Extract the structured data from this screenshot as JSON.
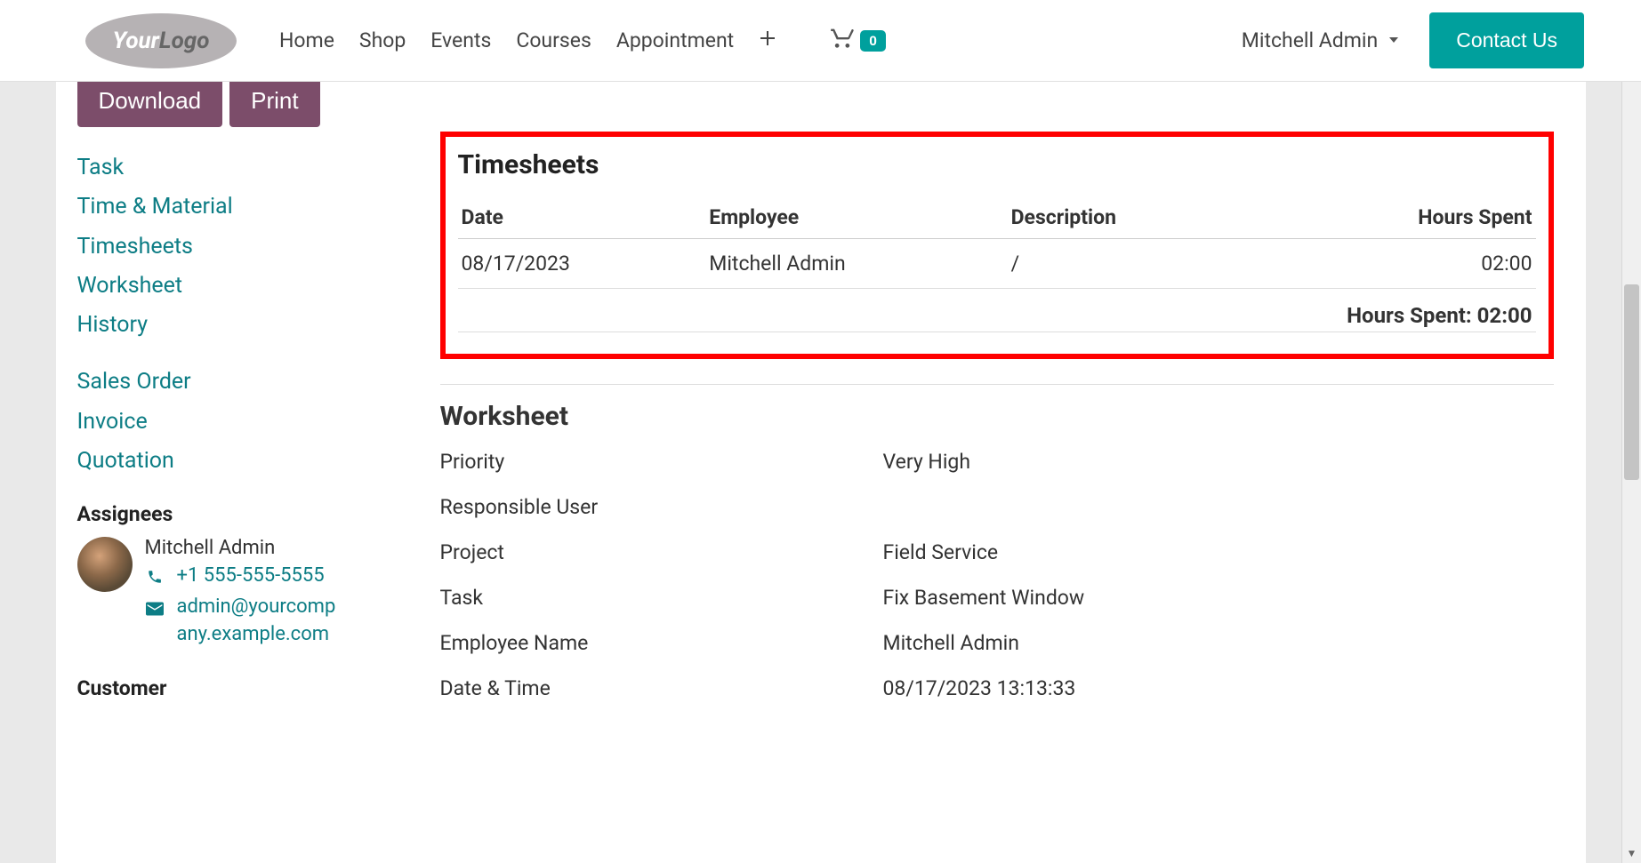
{
  "nav": {
    "logo1": "Your",
    "logo2": "Logo",
    "links": [
      "Home",
      "Shop",
      "Events",
      "Courses",
      "Appointment"
    ],
    "cart_count": "0",
    "user": "Mitchell Admin",
    "contact": "Contact Us"
  },
  "sidebar": {
    "download": "Download",
    "print": "Print",
    "group1": [
      "Task",
      "Time & Material",
      "Timesheets",
      "Worksheet",
      "History"
    ],
    "group2": [
      "Sales Order",
      "Invoice",
      "Quotation"
    ],
    "assignees_title": "Assignees",
    "assignee": {
      "name": "Mitchell Admin",
      "phone": "+1 555-555-5555",
      "email": "admin@yourcompany.example.com"
    },
    "customer_title": "Customer"
  },
  "timesheets": {
    "title": "Timesheets",
    "headers": {
      "date": "Date",
      "employee": "Employee",
      "desc": "Description",
      "hours": "Hours Spent"
    },
    "rows": [
      {
        "date": "08/17/2023",
        "employee": "Mitchell Admin",
        "desc": "/",
        "hours": "02:00"
      }
    ],
    "total_label": "Hours Spent: ",
    "total_value": "02:00"
  },
  "worksheet": {
    "title": "Worksheet",
    "rows": [
      {
        "label": "Priority",
        "value": "Very High"
      },
      {
        "label": "Responsible User",
        "value": ""
      },
      {
        "label": "Project",
        "value": "Field Service"
      },
      {
        "label": "Task",
        "value": "Fix Basement Window"
      },
      {
        "label": "Employee Name",
        "value": "Mitchell Admin"
      },
      {
        "label": "Date & Time",
        "value": "08/17/2023 13:13:33"
      }
    ]
  }
}
